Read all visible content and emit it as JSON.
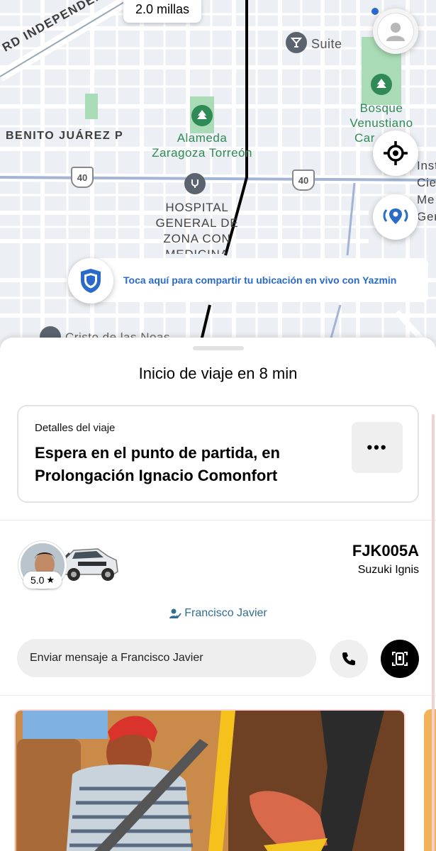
{
  "map": {
    "distance": "2.0 millas",
    "streets": {
      "independencia": "RD INDEPENDENCIA",
      "benito": "BENITO JUÁREZ P"
    },
    "places": {
      "suite": "Suite",
      "bosque_line1": "Bosque",
      "bosque_line2": "Venustiano",
      "bosque_line3": "Car",
      "alameda_line1": "Alameda",
      "alameda_line2": "Zaragoza Torreón",
      "hospital_line1": "HOSPITAL",
      "hospital_line2": "GENERAL DE",
      "hospital_line3": "ZONA CON",
      "hospital_line4": "MEDICINA",
      "inst_line1": "Inst",
      "inst_line2": "Cie",
      "inst_line3": "Me",
      "inst_line4": "Ger",
      "cristo": "Cristo de las Noas"
    },
    "highway_shields": [
      "40",
      "40"
    ],
    "share_text": "Toca aquí para compartir tu ubicación en vivo con Yazmin",
    "colors": {
      "map_bg": "#eceff3",
      "park": "#a9dcb6",
      "accent_blue": "#2a6ac8"
    }
  },
  "trip": {
    "eta_title": "Inicio de viaje en 8 min",
    "details_label": "Detalles del viaje",
    "details_text": "Espera en el punto de partida, en Prolongación Ignacio Comonfort",
    "more_label": "•••"
  },
  "driver": {
    "rating": "5.0",
    "rating_star": "★",
    "plate": "FJK005A",
    "car_model": "Suzuki Ignis",
    "name": "Francisco Javier"
  },
  "actions": {
    "message_placeholder": "Enviar mensaje a Francisco Javier"
  }
}
